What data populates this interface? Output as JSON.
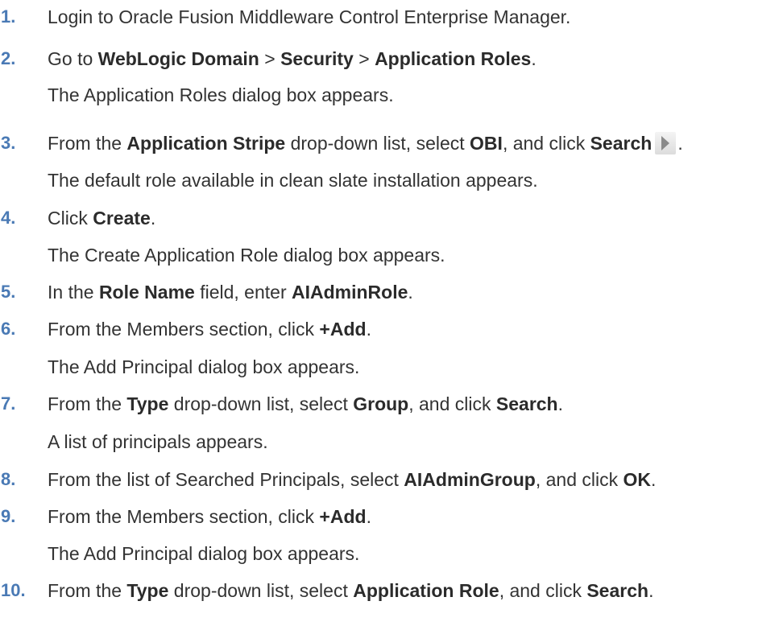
{
  "steps": [
    {
      "num": "1.",
      "parts": [
        "Login to Oracle Fusion Middleware Control Enterprise Manager."
      ]
    },
    {
      "num": "2.",
      "parts": [
        "Go to ",
        "WebLogic Domain",
        " > ",
        "Security",
        " > ",
        "Application Roles",
        "."
      ],
      "note": "The Application Roles dialog box appears."
    },
    {
      "num": "3.",
      "parts": [
        "From the ",
        "Application Stripe",
        " drop-down list, select ",
        "OBI",
        ", and click ",
        "Search",
        "."
      ],
      "note": "The default role available in clean slate installation appears."
    },
    {
      "num": "4.",
      "parts": [
        "Click ",
        "Create",
        "."
      ],
      "note": "The Create Application Role dialog box appears."
    },
    {
      "num": "5.",
      "parts": [
        "In the ",
        "Role Name",
        " field, enter ",
        "AIAdminRole",
        "."
      ]
    },
    {
      "num": "6.",
      "parts": [
        "From the Members section, click ",
        "+Add",
        "."
      ],
      "note": "The Add Principal dialog box appears."
    },
    {
      "num": "7.",
      "parts": [
        "From the ",
        "Type",
        " drop-down list, select ",
        "Group",
        ", and click ",
        "Search",
        "."
      ],
      "note": "A list of principals appears."
    },
    {
      "num": "8.",
      "parts": [
        "From the list of Searched Principals, select ",
        "AIAdminGroup",
        ", and click ",
        "OK",
        "."
      ]
    },
    {
      "num": "9.",
      "parts": [
        "From the Members section, click ",
        "+Add",
        "."
      ],
      "note": "The Add Principal dialog box appears."
    },
    {
      "num": "10.",
      "parts": [
        "From the ",
        "Type",
        " drop-down list, select ",
        "Application Role",
        ", and click ",
        "Search",
        "."
      ]
    }
  ],
  "icons": {
    "search": "search-arrow-icon"
  },
  "colors": {
    "step_number": "#4a7ab5",
    "text": "#333333"
  }
}
